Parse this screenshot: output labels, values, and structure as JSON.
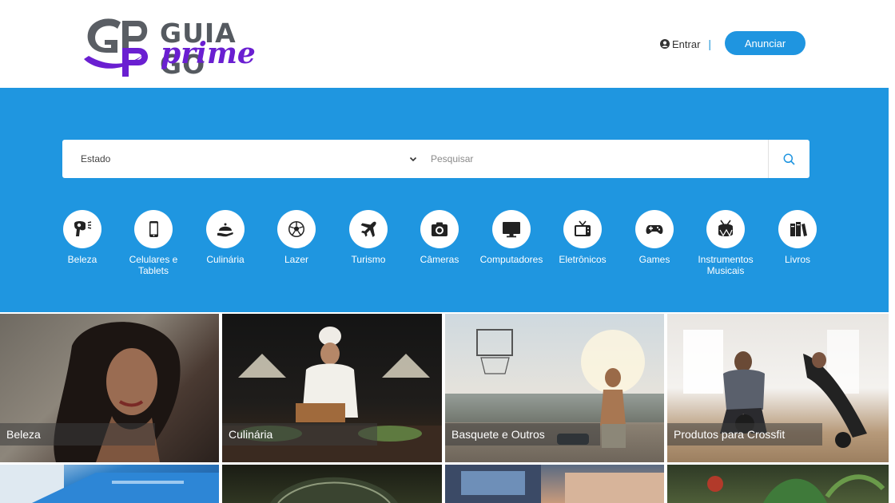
{
  "brand": {
    "name": "GUIA GO",
    "sub": "prime",
    "mark": "GP"
  },
  "header": {
    "login_label": "Entrar",
    "separator": "|",
    "announce_label": "Anunciar"
  },
  "search": {
    "state_label": "Estado",
    "placeholder": "Pesquisar"
  },
  "categories": [
    {
      "label": "Beleza",
      "icon": "hair-dryer-icon"
    },
    {
      "label": "Celulares e Tablets",
      "icon": "smartphone-icon"
    },
    {
      "label": "Culinária",
      "icon": "food-cloche-icon"
    },
    {
      "label": "Lazer",
      "icon": "soccer-ball-icon"
    },
    {
      "label": "Turismo",
      "icon": "plane-icon"
    },
    {
      "label": "Câmeras",
      "icon": "camera-icon"
    },
    {
      "label": "Computadores",
      "icon": "monitor-icon"
    },
    {
      "label": "Eletrônicos",
      "icon": "tv-icon"
    },
    {
      "label": "Games",
      "icon": "gamepad-icon"
    },
    {
      "label": "Instrumentos Musicais",
      "icon": "drum-icon"
    },
    {
      "label": "Livros",
      "icon": "books-icon"
    }
  ],
  "tiles": [
    {
      "caption": "Beleza"
    },
    {
      "caption": "Culinária"
    },
    {
      "caption": "Basquete e Outros"
    },
    {
      "caption": "Produtos para Crossfit"
    }
  ],
  "colors": {
    "brand_blue": "#1f96e0",
    "brand_purple": "#6a1fd1",
    "logo_gray": "#555a60"
  }
}
